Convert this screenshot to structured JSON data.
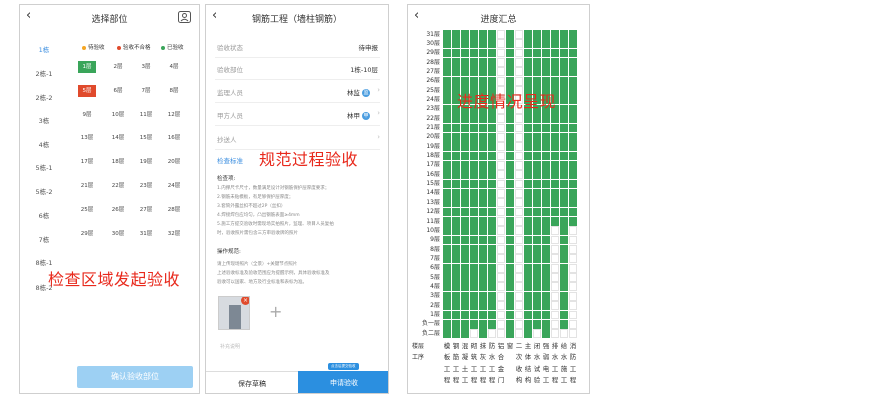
{
  "colors": {
    "pass": "#3aa55a",
    "fail": "#e04a2c",
    "pending": "#f5a623",
    "blue": "#2b8fe0",
    "annotation": "#e8291c"
  },
  "screen1": {
    "title": "选择部位",
    "back_icon": "chevron-left-icon",
    "user_icon": "user-icon",
    "legend": {
      "pending": "待验收",
      "fail": "验收不合格",
      "pass": "已验收"
    },
    "buildings": [
      "1栋",
      "2栋-1",
      "2栋-2",
      "3栋",
      "4栋",
      "5栋-1",
      "5栋-2",
      "6栋",
      "7栋",
      "8栋-1",
      "8栋-2"
    ],
    "floor_rows": [
      [
        "1层",
        "2层",
        "3层",
        "4层"
      ],
      [
        "5层",
        "6层",
        "7层",
        "8层"
      ],
      [
        "9层",
        "10层",
        "11层",
        "12层"
      ],
      [
        "13层",
        "14层",
        "15层",
        "16层"
      ],
      [
        "17层",
        "18层",
        "19层",
        "20层"
      ],
      [
        "21层",
        "22层",
        "23层",
        "24层"
      ],
      [
        "25层",
        "26层",
        "27层",
        "28层"
      ],
      [
        "29层",
        "30层",
        "31层",
        "32层"
      ]
    ],
    "confirm_button": "确认验收部位",
    "annotation": "检查区域发起验收"
  },
  "screen2": {
    "title": "钢筋工程（墙柱钢筋）",
    "back_icon": "chevron-left-icon",
    "fields": [
      {
        "label": "验收状态",
        "value": "待申报"
      },
      {
        "label": "验收部位",
        "value": "1栋-10层"
      },
      {
        "label": "监理人员",
        "value": "林监",
        "badge": "监"
      },
      {
        "label": "甲方人员",
        "value": "林甲",
        "badge": "甲"
      },
      {
        "label": "抄送人",
        "value": ""
      }
    ],
    "standard_link": "检查标准",
    "check_items_title": "检查项:",
    "check_items": [
      "1.内撑尺卡尺寸，数量满足设计对钢筋保护层厚度要求；",
      "2.钢筋未贴模板，有足够保护层厚度；",
      "3.套筒外露丝扣不超过2P（丝扣）",
      "4.焊接焊包应均匀，凸出钢筋表面≥4mm",
      "5.施工方提交验收时需现场实拍照片，监理、项目人员复拍",
      "时，验收照片需包含三方审验收牌的照片"
    ],
    "operation_title": "操作规范:",
    "operation_lines": [
      "请上传现场照片（全景）+关键节点照片",
      "上述验收标准及验收范围应为提醒示例，具体验收标准及",
      "验收可以国家、地方及行业标准和表标为准。"
    ],
    "photo_icon": "delete-icon",
    "add_photo_icon": "plus-icon",
    "remark_placeholder": "补充说明",
    "save_button": "保存草稿",
    "submit_button": "申请验收",
    "submit_tip": "点击后提交验收",
    "annotation": "规范过程验收"
  },
  "screen3": {
    "title": "进度汇总",
    "back_icon": "chevron-left-icon",
    "floors": [
      "31层",
      "30层",
      "29层",
      "28层",
      "27层",
      "26层",
      "25层",
      "24层",
      "23层",
      "22层",
      "21层",
      "20层",
      "19层",
      "18层",
      "17层",
      "16层",
      "15层",
      "14层",
      "13层",
      "12层",
      "11层",
      "10层",
      "9层",
      "8层",
      "7层",
      "6层",
      "5层",
      "4层",
      "3层",
      "2层",
      "1层",
      "负一层",
      "负二层"
    ],
    "floor_header": "楼层",
    "process_header": "工序",
    "processes": [
      [
        "模",
        "板",
        "工",
        "程"
      ],
      [
        "钢",
        "筋",
        "工",
        "程"
      ],
      [
        "混",
        "凝",
        "土",
        "工"
      ],
      [
        "砌",
        "筑",
        "工",
        "程"
      ],
      [
        "抹",
        "灰",
        "工",
        "程"
      ],
      [
        "防",
        "水",
        "工",
        "程"
      ],
      [
        "铝",
        "合",
        "金",
        "门"
      ],
      [
        "窗",
        "",
        "",
        ""
      ],
      [
        "二",
        "次",
        "收",
        "构"
      ],
      [
        "主",
        "体",
        "结",
        "构"
      ],
      [
        "闭",
        "水",
        "试",
        "验"
      ],
      [
        "强",
        "弱",
        "电",
        "工"
      ],
      [
        "排",
        "水",
        "工",
        "程"
      ],
      [
        "给",
        "水",
        "施",
        "工"
      ],
      [
        "消",
        "防",
        "工",
        "程"
      ]
    ],
    "progress_top_floor": [
      31,
      31,
      31,
      31,
      31,
      31,
      10,
      31,
      31,
      31,
      31,
      31,
      31,
      31,
      31
    ],
    "progress_min_floor": [
      -2,
      -2,
      -2,
      -1,
      -2,
      -1,
      99,
      -2,
      99,
      -2,
      -1,
      -2,
      11,
      -1,
      11
    ],
    "annotation": "进度情况呈现"
  }
}
